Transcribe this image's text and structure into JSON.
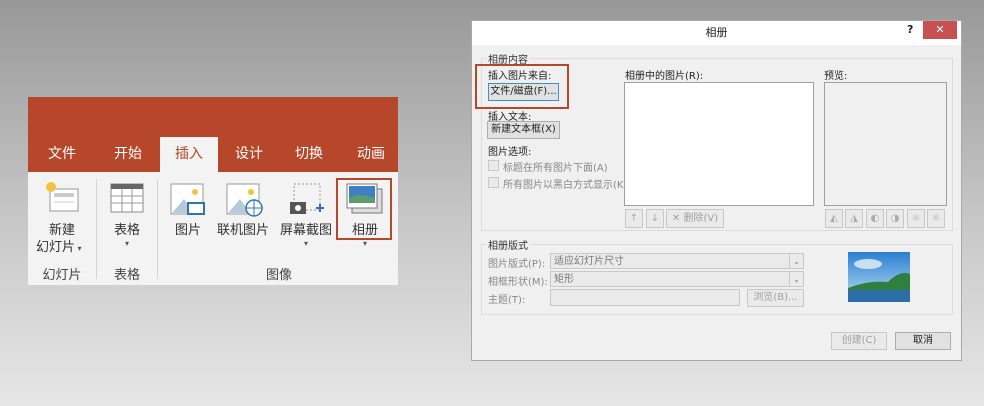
{
  "ribbon": {
    "tabs": [
      "文件",
      "开始",
      "插入",
      "设计",
      "切换",
      "动画"
    ],
    "active_tab": "插入",
    "accent_color": "#b7472a",
    "buttons": {
      "new_slide_line1": "新建",
      "new_slide_line2": "幻灯片",
      "table": "表格",
      "picture": "图片",
      "online_picture": "联机图片",
      "screenshot": "屏幕截图",
      "photo_album": "相册"
    },
    "groups": {
      "slides": "幻灯片",
      "tables": "表格",
      "images": "图像"
    }
  },
  "dialog": {
    "title": "相册",
    "help": "?",
    "close": "✕",
    "content_group": "相册内容",
    "insert_from_label": "插入图片来自:",
    "file_disk_button": "文件/磁盘(F)...",
    "insert_text_label": "插入文本:",
    "new_textbox_button": "新建文本框(X)",
    "picture_options_label": "图片选项:",
    "option_captions": "标题在所有图片下面(A)",
    "option_bw": "所有图片以黑白方式显示(K)",
    "pictures_in_album_label": "相册中的图片(R):",
    "move_up": "↑",
    "move_down": "↓",
    "remove_button": "删除(V)",
    "preview_label": "预览:",
    "layout_group": "相册版式",
    "picture_layout_label": "图片版式(P):",
    "picture_layout_value": "适应幻灯片尺寸",
    "frame_shape_label": "相框形状(M):",
    "frame_shape_value": "矩形",
    "theme_label": "主题(T):",
    "theme_value": "",
    "browse_button": "浏览(B)...",
    "create_button": "创建(C)",
    "cancel_button": "取消"
  }
}
